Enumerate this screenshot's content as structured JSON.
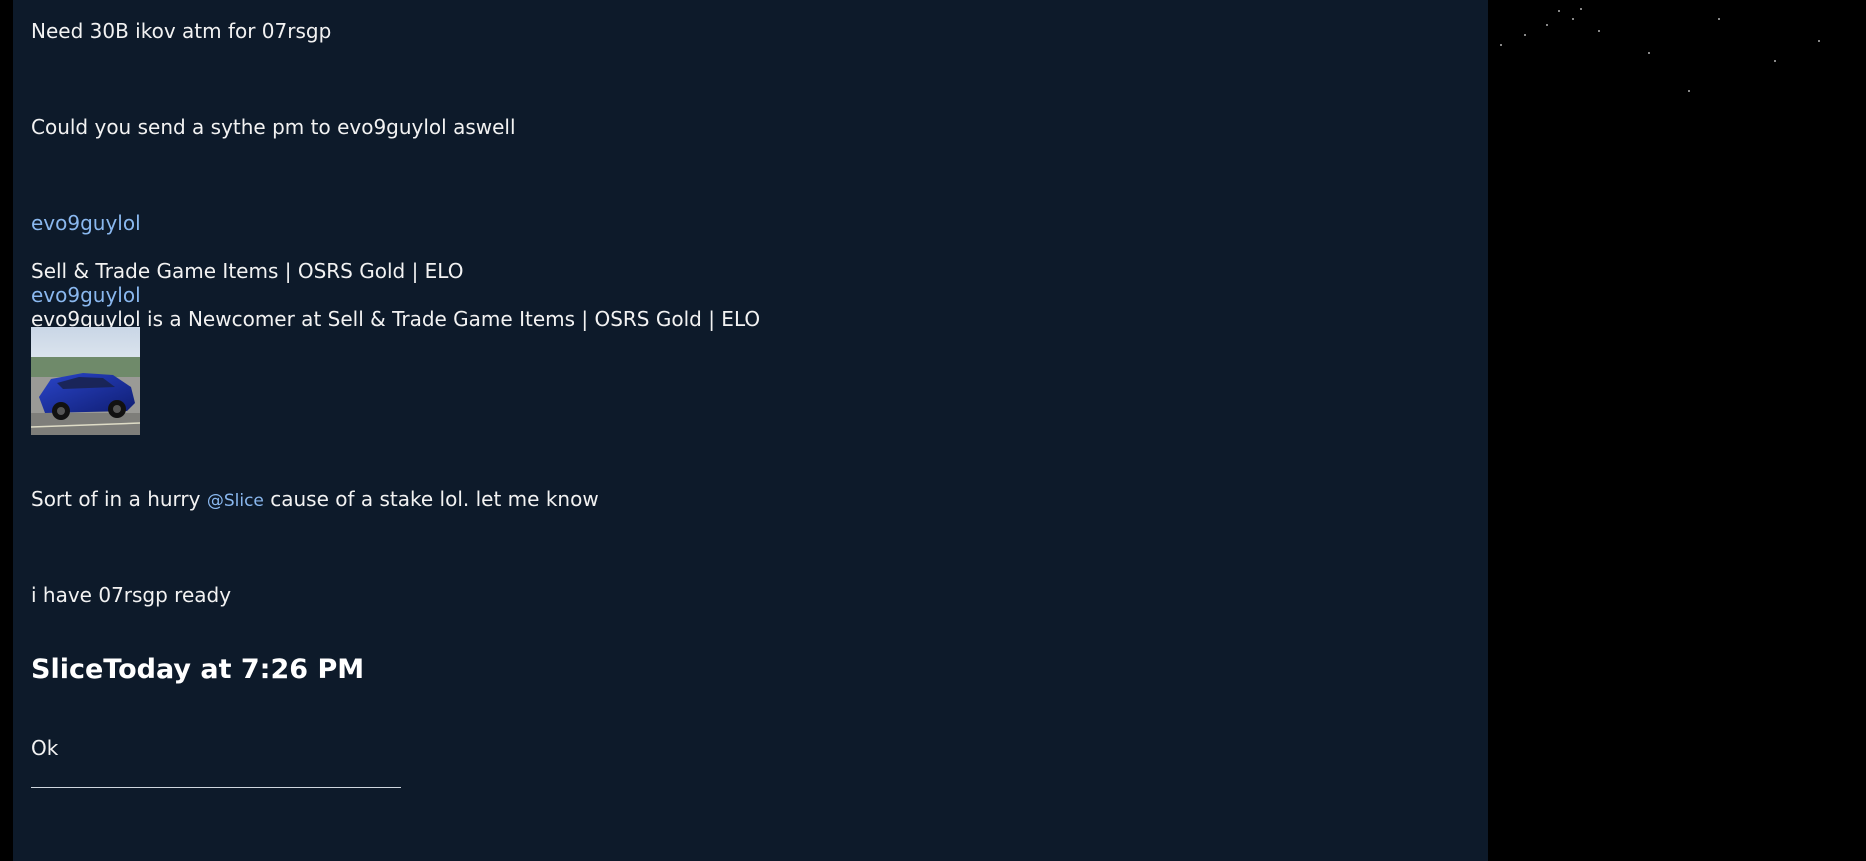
{
  "thread": {
    "messages": [
      "Need 30B ikov atm for 07rsgp",
      "Could you send a sythe pm to evo9guylol aswell"
    ]
  },
  "profile_card": {
    "username_link": "evo9guylol",
    "forum_name": "Sell & Trade Game Items | OSRS Gold | ELO",
    "username_link_2": "evo9guylol",
    "rank_text": "evo9guylol is a Newcomer at Sell & Trade Game Items | OSRS Gold | ELO",
    "avatar_icon": "car-photo-avatar"
  },
  "reply": {
    "text_before": "Sort of in a hurry ",
    "mention": "@Slice",
    "text_after": " cause of a stake lol. let me know"
  },
  "reply_2": {
    "text": "i have 07rsgp ready"
  },
  "post": {
    "heading": "SliceToday at 7:26 PM",
    "body": "Ok"
  },
  "colors": {
    "content_bg": "#0d1a2a",
    "link": "#8ab8ef",
    "text": "#f2f2f2"
  }
}
